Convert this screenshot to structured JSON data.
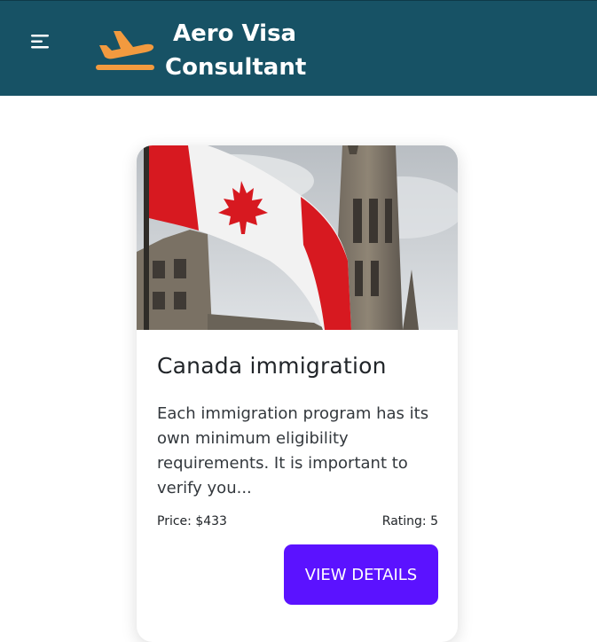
{
  "colors": {
    "navbar_bg": "#175265",
    "logo_orange": "#f29a3f",
    "button_bg": "#5b12ff",
    "text_dark": "#212529"
  },
  "navbar": {
    "menu_icon": "hamburger-menu-icon",
    "logo_icon": "airplane-takeoff-icon",
    "brand_line1": "Aero Visa",
    "brand_line2": "Consultant"
  },
  "card": {
    "image_icon": "canada-flag-parliament-photo",
    "title": "Canada immigration",
    "description": "Each immigration program has its own minimum eligibility requirements. It is important to verify you...",
    "price": "Price: $433",
    "rating": "Rating: 5",
    "button_label": "VIEW DETAILS"
  }
}
